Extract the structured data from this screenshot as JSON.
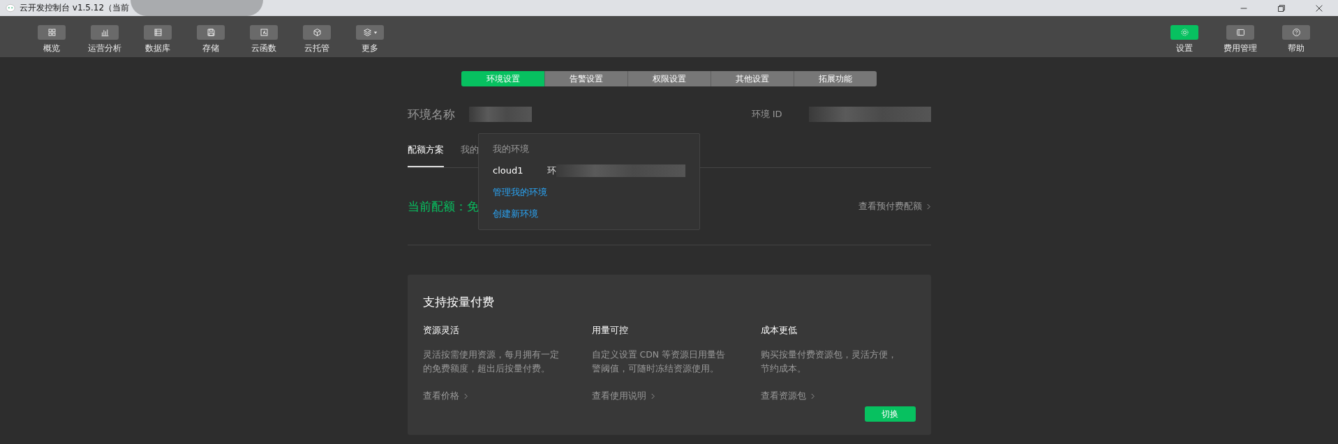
{
  "window": {
    "title": "云开发控制台 v1.5.12（当前"
  },
  "toolbar": {
    "left": [
      {
        "label": "概览",
        "selected": false
      },
      {
        "label": "运营分析",
        "selected": false
      },
      {
        "label": "数据库",
        "selected": false
      },
      {
        "label": "存储",
        "selected": false
      },
      {
        "label": "云函数",
        "selected": false
      },
      {
        "label": "云托管",
        "selected": false
      },
      {
        "label": "更多",
        "selected": false
      }
    ],
    "right": [
      {
        "label": "设置",
        "selected": true
      },
      {
        "label": "费用管理",
        "selected": false
      },
      {
        "label": "帮助",
        "selected": false
      }
    ]
  },
  "tabs": [
    {
      "label": "环境设置",
      "selected": true
    },
    {
      "label": "告警设置",
      "selected": false
    },
    {
      "label": "权限设置",
      "selected": false
    },
    {
      "label": "其他设置",
      "selected": false
    },
    {
      "label": "拓展功能",
      "selected": false
    }
  ],
  "env": {
    "name_label": "环境名称",
    "id_label": "环境 ID"
  },
  "subtabs": [
    {
      "label": "配额方案",
      "selected": true
    },
    {
      "label": "我的",
      "selected": false
    }
  ],
  "quota": {
    "current": "当前配额：免",
    "link": "查看预付费配额"
  },
  "dropdown": {
    "header": "我的环境",
    "env": {
      "name": "cloud1",
      "id": "环"
    },
    "actions": [
      "管理我的环境",
      "创建新环境"
    ]
  },
  "card": {
    "title": "支持按量付费",
    "features": [
      {
        "title": "资源灵活",
        "text": "灵活按需使用资源，每月拥有一定的免费额度，超出后按量付费。",
        "link": "查看价格"
      },
      {
        "title": "用量可控",
        "text": "自定义设置 CDN 等资源日用量告警阈值，可随时冻结资源使用。",
        "link": "查看使用说明"
      },
      {
        "title": "成本更低",
        "text": "购买按量付费资源包，灵活方便，节约成本。",
        "link": "查看资源包"
      }
    ],
    "button": "切换"
  }
}
